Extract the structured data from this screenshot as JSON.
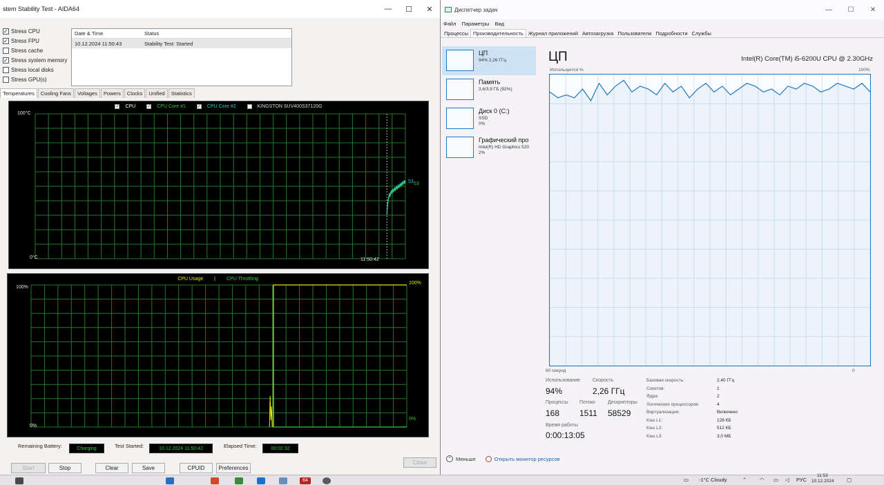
{
  "aida": {
    "title": "stem Stability Test - AIDA64",
    "window_buttons": [
      "—",
      "☐",
      "✕"
    ],
    "stress_options": [
      {
        "label": "Stress CPU",
        "checked": true
      },
      {
        "label": "Stress FPU",
        "checked": true
      },
      {
        "label": "Stress cache",
        "checked": false
      },
      {
        "label": "Stress system memory",
        "checked": true
      },
      {
        "label": "Stress local disks",
        "checked": false
      },
      {
        "label": "Stress GPU(s)",
        "checked": false
      }
    ],
    "log": {
      "col_date": "Date & Time",
      "col_status": "Status",
      "rows": [
        {
          "date": "10.12.2024 11:50:43",
          "status": "Stability Test: Started"
        }
      ]
    },
    "tabs": [
      "Temperatures",
      "Cooling Fans",
      "Voltages",
      "Powers",
      "Clocks",
      "Unified",
      "Statistics"
    ],
    "temp_graph": {
      "legend": [
        {
          "label": "CPU",
          "color": "#ffffff"
        },
        {
          "label": "CPU Core #1",
          "color": "#2ecc40"
        },
        {
          "label": "CPU Core #2",
          "color": "#35c8c8"
        },
        {
          "label": "KINGSTON SUV400S37120G",
          "color": "#dddddd",
          "checked": false
        }
      ],
      "y_max_label": "100°C",
      "y_min_label": "0°C",
      "time_label": "11:50:42",
      "value_labels": [
        "53",
        "53"
      ],
      "trace_start": 0.95,
      "trace_values": [
        30,
        36,
        40,
        42,
        44,
        43,
        45,
        46,
        45,
        47,
        46,
        47,
        48,
        47,
        48,
        49,
        48,
        49,
        50,
        49,
        50,
        51,
        50,
        51,
        52,
        51,
        52,
        53,
        52,
        53
      ]
    },
    "usage_graph": {
      "legend": [
        {
          "label": "CPU Usage",
          "color": "#e8e800"
        },
        {
          "label": "|",
          "color": "#cccccc"
        },
        {
          "label": "CPU Throttling",
          "color": "#2ecc40"
        }
      ],
      "y_max_label": "100%",
      "y_min_label": "0%",
      "right_max_label": "100%",
      "right_min_label": "0%",
      "spike_position": 0.64,
      "jump_position": 0.645,
      "usage_after": 100,
      "throttling": 0
    },
    "status_bar": {
      "battery_label": "Remaining Battery:",
      "battery_value": "Charging",
      "started_label": "Test Started:",
      "started_value": "10.12.2024 11:50:42",
      "elapsed_label": "Elapsed Time:",
      "elapsed_value": "00:02:32"
    },
    "buttons": {
      "start": "Start",
      "stop": "Stop",
      "clear": "Clear",
      "save": "Save",
      "cpuid": "CPUID",
      "preferences": "Preferences",
      "close": "Close"
    }
  },
  "taskmgr": {
    "title": "Диспетчер задач",
    "window_buttons": [
      "—",
      "☐",
      "✕"
    ],
    "menu": [
      "Файл",
      "Параметры",
      "Вид"
    ],
    "tabs": [
      "Процессы",
      "Производительность",
      "Журнал приложений",
      "Автозагрузка",
      "Пользователи",
      "Подробности",
      "Службы"
    ],
    "sidebar": [
      {
        "title": "ЦП",
        "line1": "94% 2,26 ГГц",
        "line2": ""
      },
      {
        "title": "Память",
        "line1": "3,6/3,9 ГБ (92%)",
        "line2": ""
      },
      {
        "title": "Диск 0 (C:)",
        "line1": "SSD",
        "line2": "0%"
      },
      {
        "title": "Графический про",
        "line1": "Intel(R) HD Graphics 520",
        "line2": "2%"
      }
    ],
    "cpu_title": "ЦП",
    "cpu_model": "Intel(R) Core(TM) i5-6200U CPU @ 2.30GHz",
    "graph_label": "Используется %",
    "graph_max": "100%",
    "graph_time": "60 секунд",
    "graph_min": "0",
    "cpu_series": [
      94,
      92,
      93,
      92,
      95,
      91,
      97,
      93,
      96,
      98,
      94,
      96,
      95,
      93,
      97,
      94,
      96,
      92,
      95,
      97,
      94,
      96,
      93,
      95,
      97,
      96,
      94,
      95,
      93,
      96,
      95,
      97,
      96,
      94,
      95,
      97,
      96,
      95,
      97,
      94
    ],
    "stats": {
      "usage_label": "Использование",
      "usage_value": "94%",
      "speed_label": "Скорость",
      "speed_value": "2,26 ГГц",
      "proc_label": "Процессы",
      "proc_value": "168",
      "threads_label": "Потоки",
      "threads_value": "1511",
      "handles_label": "Дескрипторы",
      "handles_value": "58529",
      "uptime_label": "Время работы",
      "uptime_value": "0:00:13:05"
    },
    "info": [
      {
        "label": "Базовая скорость:",
        "value": "2,40 ГГц"
      },
      {
        "label": "Сокетов:",
        "value": "1"
      },
      {
        "label": "Ядра:",
        "value": "2"
      },
      {
        "label": "Логических процессоров:",
        "value": "4"
      },
      {
        "label": "Виртуализация:",
        "value": "Включено"
      },
      {
        "label": "Кэш L1:",
        "value": "128 КБ"
      },
      {
        "label": "Кэш L2:",
        "value": "512 КБ"
      },
      {
        "label": "Кэш L3:",
        "value": "3,0 МБ"
      }
    ],
    "fewer_details": "Меньше",
    "open_monitor": "Открыть монитор ресурсов"
  },
  "taskbar": {
    "weather": "-1°C Cloudy",
    "lang": "РУС",
    "time": "11:53",
    "date": "10.12.2024",
    "app_badge": "64"
  }
}
